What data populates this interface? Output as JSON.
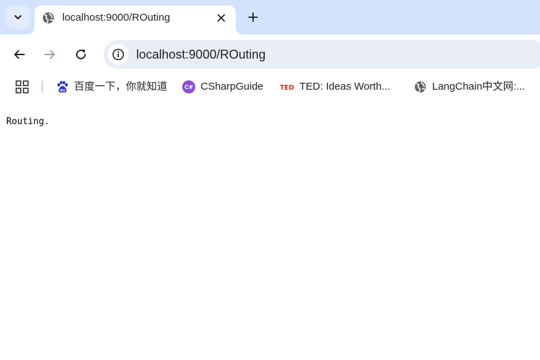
{
  "tab": {
    "title": "localhost:9000/ROuting",
    "favicon": "globe-icon"
  },
  "toolbar": {
    "url": "localhost:9000/ROuting"
  },
  "bookmarks": [
    {
      "label": "百度一下，你就知道",
      "icon": "baidu-paw-icon"
    },
    {
      "label": "CSharpGuide",
      "icon": "csharp-icon"
    },
    {
      "label": "TED: Ideas Worth...",
      "icon": "ted-logo-icon"
    },
    {
      "label": "LangChain中文网:...",
      "icon": "globe-icon"
    }
  ],
  "page": {
    "text": "Routing."
  },
  "colors": {
    "tabstrip": "#d3e3fd",
    "omnibox": "#e9eef6",
    "ted_red": "#e62b1e",
    "csharp_purple": "#8a4fd6",
    "baidu_blue": "#2932e1"
  }
}
